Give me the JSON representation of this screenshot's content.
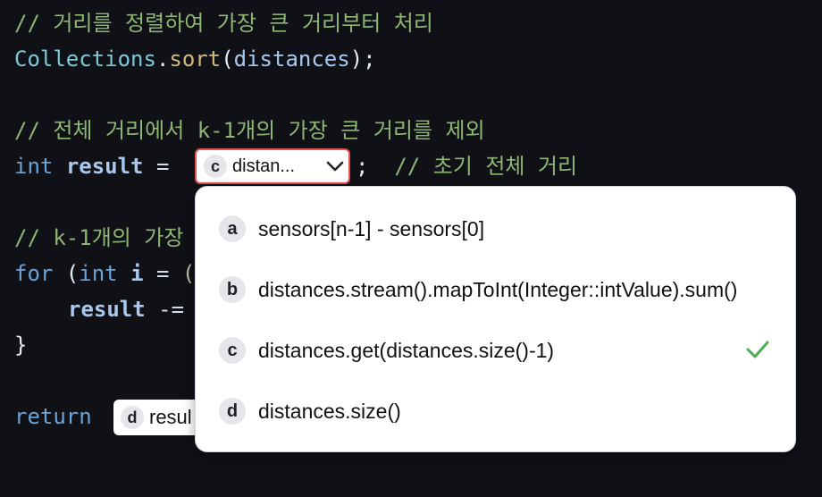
{
  "code": {
    "line1_comment": "// 거리를 정렬하여 가장 큰 거리부터 처리",
    "line2": {
      "cls": "Collections",
      "dot": ".",
      "fn": "sort",
      "open": "(",
      "arg": "distances",
      "close": ");"
    },
    "line4_comment": "// 전체 거리에서 k-1개의 가장 큰 거리를 제외",
    "line5": {
      "type": "int",
      "var": "result",
      "eq": " = ",
      "semi": ";",
      "comment": "// 초기 전체 거리"
    },
    "line7_comment": "// k-1개의 가장",
    "line8": {
      "kw": "for",
      "open": " (",
      "type": "int",
      "var": "i",
      "eq": " = ",
      "rest": "("
    },
    "line9": {
      "var": "result",
      "op": " -="
    },
    "line10": "}",
    "line12": {
      "kw": "return"
    }
  },
  "blank_1": {
    "badge": "c",
    "value": "distan...",
    "icon": "chevron-down-icon"
  },
  "blank_2": {
    "badge": "d",
    "value": "resul"
  },
  "dropdown": {
    "options": [
      {
        "badge": "a",
        "text": "sensors[n-1] - sensors[0]",
        "selected": false
      },
      {
        "badge": "b",
        "text": "distances.stream().mapToInt(Integer::intValue).sum()",
        "selected": false
      },
      {
        "badge": "c",
        "text": "distances.get(distances.size()-1)",
        "selected": true
      },
      {
        "badge": "d",
        "text": "distances.size()",
        "selected": false
      }
    ],
    "selected_icon": "check-icon"
  },
  "colors": {
    "background": "#0f1117",
    "comment": "#8fb573",
    "keyword": "#6aa3d8",
    "blank_border": "#e45151",
    "check": "#4caf50"
  }
}
